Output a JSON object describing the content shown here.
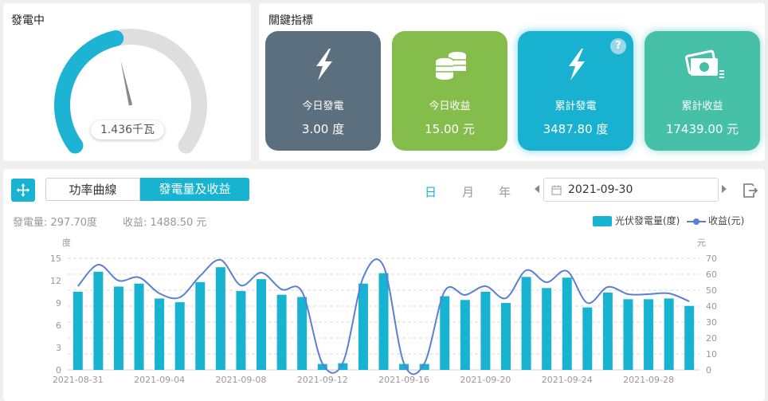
{
  "generation_panel": {
    "title": "發電中",
    "gauge_value": "1.436千瓦",
    "gauge_fill_fraction": 0.45,
    "gauge_color": "#1db3d4",
    "gauge_track_color": "#dedede"
  },
  "kpi_panel": {
    "title": "關鍵指標",
    "cards": [
      {
        "label": "今日發電",
        "value": "3.00 度",
        "icon": "lightning-bolt-icon",
        "color": "#5b6f7f"
      },
      {
        "label": "今日收益",
        "value": "15.00 元",
        "icon": "coin-stack-icon",
        "color": "#84bd4b"
      },
      {
        "label": "累計發電",
        "value": "3487.80 度",
        "icon": "lightning-bolt-icon",
        "color": "#18b2d0",
        "help": "?"
      },
      {
        "label": "累計收益",
        "value": "17439.00 元",
        "icon": "cash-icon",
        "color": "#47c0a8"
      }
    ]
  },
  "chart_panel": {
    "tabs": {
      "power_curve": "功率曲線",
      "energy_revenue": "發電量及收益"
    },
    "periods": {
      "day": "日",
      "month": "月",
      "year": "年"
    },
    "date": "2021-09-30",
    "summary": {
      "energy": "發電量:  297.70度",
      "revenue": "收益:  1488.50 元"
    },
    "legend": {
      "energy": "光伏發電量(度)",
      "revenue": "收益(元)"
    },
    "left_unit": "度",
    "right_unit": "元",
    "colors": {
      "bar": "#17b3d1",
      "line": "#5b7fd4",
      "accent": "#17b3d1"
    }
  },
  "chart_data": {
    "type": "bar",
    "x": [
      "2021-08-31",
      "2021-09-01",
      "2021-09-02",
      "2021-09-03",
      "2021-09-04",
      "2021-09-05",
      "2021-09-06",
      "2021-09-07",
      "2021-09-08",
      "2021-09-09",
      "2021-09-10",
      "2021-09-11",
      "2021-09-12",
      "2021-09-13",
      "2021-09-14",
      "2021-09-15",
      "2021-09-16",
      "2021-09-17",
      "2021-09-18",
      "2021-09-19",
      "2021-09-20",
      "2021-09-21",
      "2021-09-22",
      "2021-09-23",
      "2021-09-24",
      "2021-09-25",
      "2021-09-26",
      "2021-09-27",
      "2021-09-28",
      "2021-09-29",
      "2021-09-30"
    ],
    "x_tick_labels": [
      "2021-08-31",
      "2021-09-04",
      "2021-09-08",
      "2021-09-12",
      "2021-09-16",
      "2021-09-20",
      "2021-09-24",
      "2021-09-28"
    ],
    "series": [
      {
        "name": "光伏發電量(度)",
        "type": "bar",
        "axis": "left",
        "values": [
          10.5,
          13.2,
          11.2,
          11.6,
          9.6,
          9.1,
          11.8,
          13.8,
          10.6,
          12.2,
          10.1,
          9.8,
          0.8,
          0.9,
          11.6,
          13.0,
          0.8,
          0.8,
          9.9,
          9.4,
          10.5,
          9.0,
          12.5,
          11.0,
          12.4,
          8.4,
          10.4,
          9.5,
          9.5,
          9.6,
          8.6
        ]
      },
      {
        "name": "收益(元)",
        "type": "line",
        "axis": "right",
        "values": [
          52.5,
          66.0,
          56.0,
          58.0,
          48.0,
          45.5,
          59.0,
          69.0,
          53.0,
          61.0,
          50.5,
          49.0,
          4.0,
          4.5,
          58.0,
          65.0,
          4.0,
          4.0,
          49.5,
          47.0,
          52.5,
          45.0,
          62.5,
          55.0,
          62.0,
          42.0,
          52.0,
          47.5,
          47.5,
          48.0,
          43.0
        ]
      }
    ],
    "y_left": {
      "range": [
        0,
        15
      ],
      "ticks": [
        0,
        3,
        6,
        9,
        12,
        15
      ]
    },
    "y_right": {
      "range": [
        0,
        70
      ],
      "ticks": [
        0,
        10,
        20,
        30,
        40,
        50,
        60,
        70
      ]
    },
    "grid": true,
    "legend_position": "top-right"
  }
}
